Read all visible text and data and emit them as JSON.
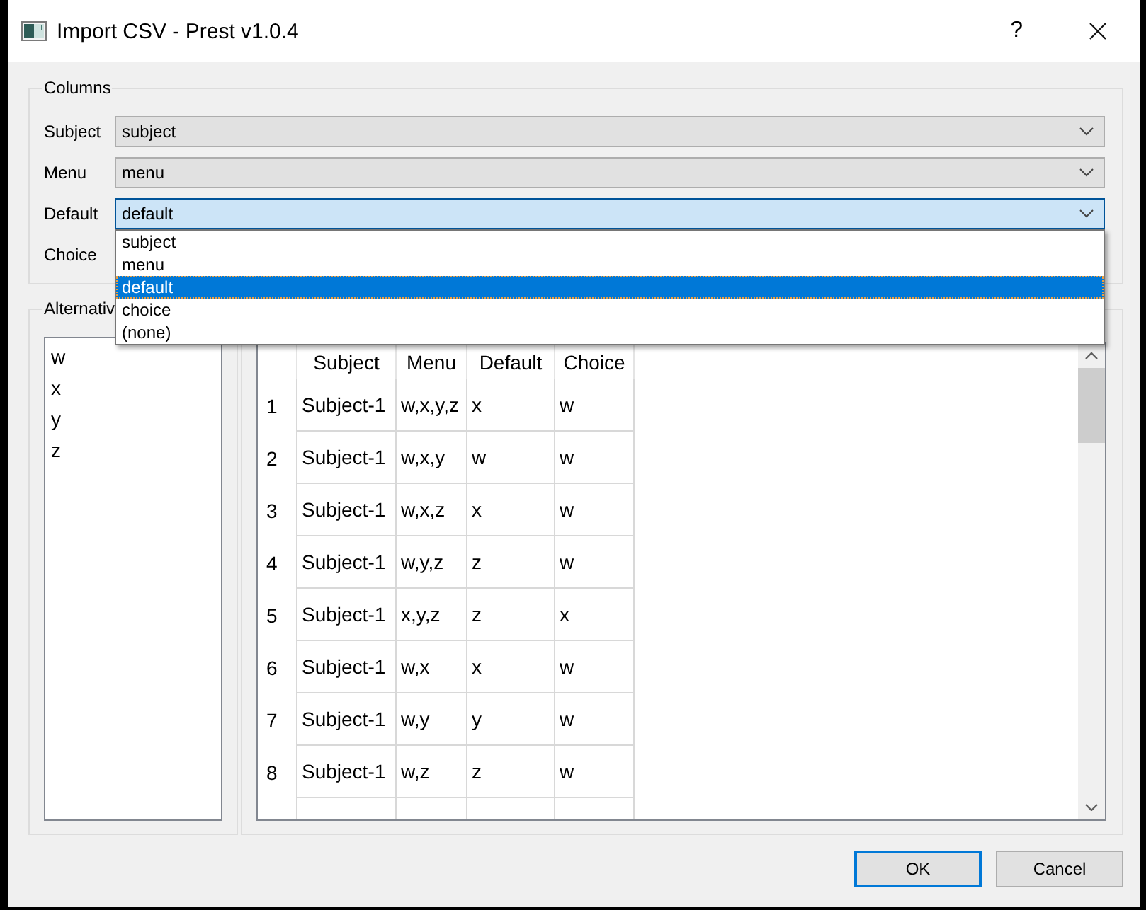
{
  "window": {
    "title": "Import CSV - Prest v1.0.4",
    "help": "?"
  },
  "columns_group": {
    "title": "Columns",
    "fields": [
      {
        "label": "Subject",
        "value": "subject",
        "focused": false
      },
      {
        "label": "Menu",
        "value": "menu",
        "focused": false
      },
      {
        "label": "Default",
        "value": "default",
        "focused": true,
        "options": [
          {
            "label": "subject",
            "selected": false
          },
          {
            "label": "menu",
            "selected": false
          },
          {
            "label": "default",
            "selected": true
          },
          {
            "label": "choice",
            "selected": false
          },
          {
            "label": "(none)",
            "selected": false
          }
        ]
      },
      {
        "label": "Choice"
      }
    ]
  },
  "alternatives": {
    "title": "Alternativ",
    "items": [
      "w",
      "x",
      "y",
      "z"
    ]
  },
  "table": {
    "columns": [
      "Subject",
      "Menu",
      "Default",
      "Choice"
    ],
    "rows": [
      {
        "number": "1",
        "cells": [
          "Subject-1",
          "w,x,y,z",
          "x",
          "w"
        ]
      },
      {
        "number": "2",
        "cells": [
          "Subject-1",
          "w,x,y",
          "w",
          "w"
        ]
      },
      {
        "number": "3",
        "cells": [
          "Subject-1",
          "w,x,z",
          "x",
          "w"
        ]
      },
      {
        "number": "4",
        "cells": [
          "Subject-1",
          "w,y,z",
          "z",
          "w"
        ]
      },
      {
        "number": "5",
        "cells": [
          "Subject-1",
          "x,y,z",
          "z",
          "x"
        ]
      },
      {
        "number": "6",
        "cells": [
          "Subject-1",
          "w,x",
          "x",
          "w"
        ]
      },
      {
        "number": "7",
        "cells": [
          "Subject-1",
          "w,y",
          "y",
          "w"
        ]
      },
      {
        "number": "8",
        "cells": [
          "Subject-1",
          "w,z",
          "z",
          "w"
        ]
      }
    ]
  },
  "buttons": [
    {
      "label": "OK",
      "default": true
    },
    {
      "label": "Cancel",
      "default": false
    }
  ]
}
